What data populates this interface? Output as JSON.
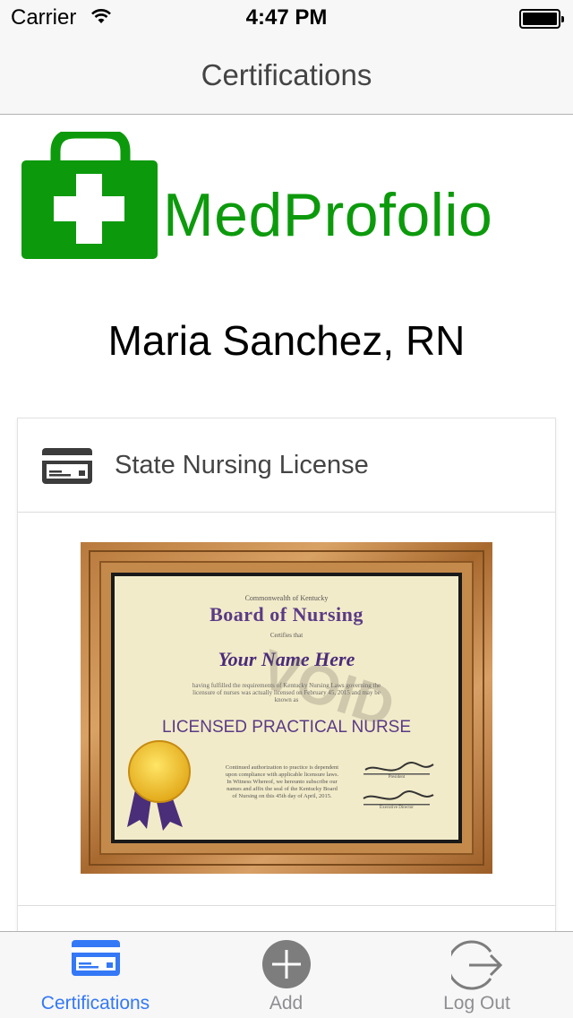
{
  "status_bar": {
    "carrier": "Carrier",
    "time": "4:47 PM"
  },
  "nav": {
    "title": "Certifications"
  },
  "brand": {
    "name": "MedProfolio",
    "color": "#0c9a0c"
  },
  "profile": {
    "name": "Maria Sanchez, RN"
  },
  "certification_card": {
    "icon": "credit-card-icon",
    "title": "State Nursing License",
    "certificate_image": {
      "header": "Commonwealth of Kentucky",
      "board": "Board of Nursing",
      "certifies": "Certifies that",
      "name": "Your Name Here",
      "body": "having fulfilled the requirements of Kentucky Nursing Laws governing the licensure of nurses was actually licensed on February 45, 2015 and may be known as",
      "license_title": "LICENSED PRACTICAL NURSE",
      "watermark": "VOID",
      "footer": "Continued authorization to practice is dependent upon compliance with applicable licensure laws. In Witness Whereof, we hereunto subscribe our names and affix the seal of the Kentucky Board of Nursing on this 45th day of April, 2015.",
      "signature_1_caption": "President",
      "signature_2_caption": "Executive Director"
    }
  },
  "tab_bar": {
    "active_color": "#3478f6",
    "tabs": [
      {
        "label": "Certifications",
        "icon": "credit-card-icon",
        "active": true
      },
      {
        "label": "Add",
        "icon": "add-circle-icon",
        "active": false
      },
      {
        "label": "Log Out",
        "icon": "logout-icon",
        "active": false
      }
    ]
  }
}
